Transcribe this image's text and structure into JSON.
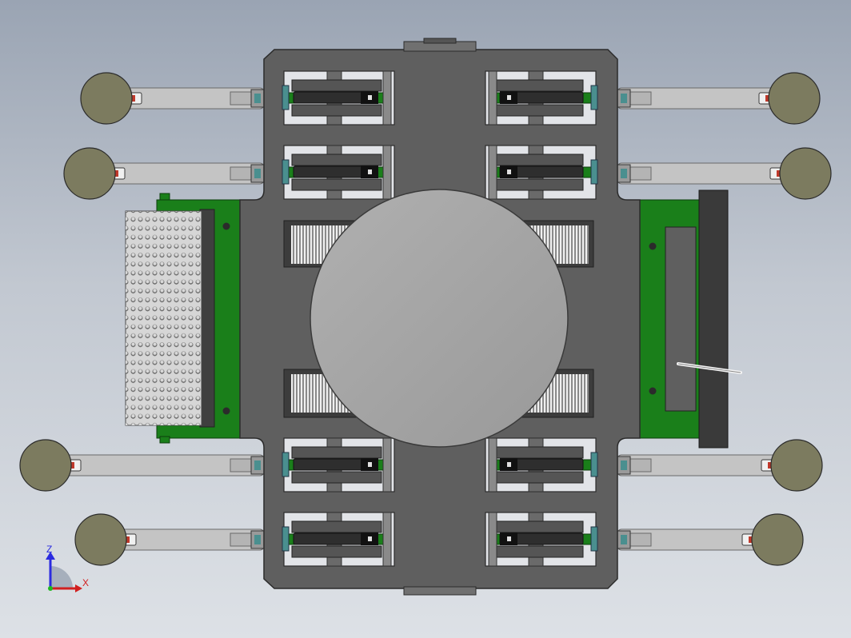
{
  "view": {
    "title": "",
    "colors": {
      "background_top": "#9aa4b3",
      "background_bottom": "#dde1e6",
      "frame": "#5f5f5f",
      "frame_edge": "#2b2b2b",
      "hub": "#a2a2a2",
      "pad": "#7c7b5f",
      "arm": "#c4c4c4",
      "green": "#1a7f1a",
      "teal": "#4a8f8f",
      "red": "#c0392b"
    }
  },
  "triad": {
    "z_label": "Z",
    "x_label": "X",
    "z_color": "#2b2be0",
    "x_color": "#d11f1f",
    "y_color": "#1fb81f"
  },
  "model": {
    "suction_pads": 8,
    "gripper_modules": 8,
    "comb_blocks": 4,
    "end_effectors": [
      "perforated-plate",
      "flat-plate"
    ]
  }
}
